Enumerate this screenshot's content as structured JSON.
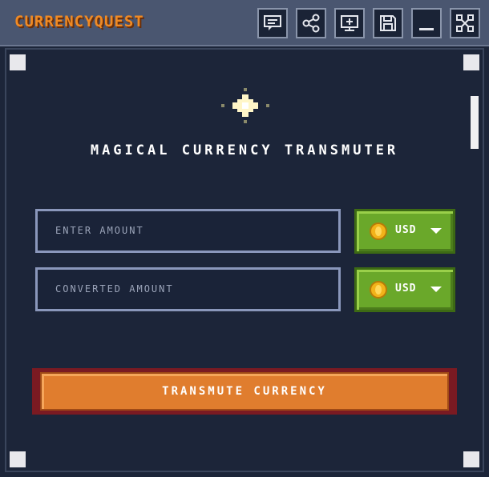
{
  "app": {
    "title": "CURRENCYQUEST"
  },
  "toolbar": {
    "buttons": [
      {
        "icon": "chat-icon"
      },
      {
        "icon": "share-icon"
      },
      {
        "icon": "add-screen-icon"
      },
      {
        "icon": "save-icon"
      },
      {
        "icon": "minimize-icon"
      },
      {
        "icon": "close-icon"
      }
    ]
  },
  "main": {
    "heading": "MAGICAL CURRENCY TRANSMUTER",
    "amount_input": {
      "placeholder": "ENTER AMOUNT",
      "value": ""
    },
    "converted_input": {
      "placeholder": "CONVERTED AMOUNT",
      "value": ""
    },
    "from_currency": {
      "label": "USD",
      "icon": "coin-icon"
    },
    "to_currency": {
      "label": "USD",
      "icon": "coin-icon"
    },
    "transmute_button": "TRANSMUTE CURRENCY"
  },
  "colors": {
    "title": "#f08a24",
    "background": "#1c2539",
    "currency_button": "#6aa82a",
    "transmute_button": "#e07d2e"
  }
}
